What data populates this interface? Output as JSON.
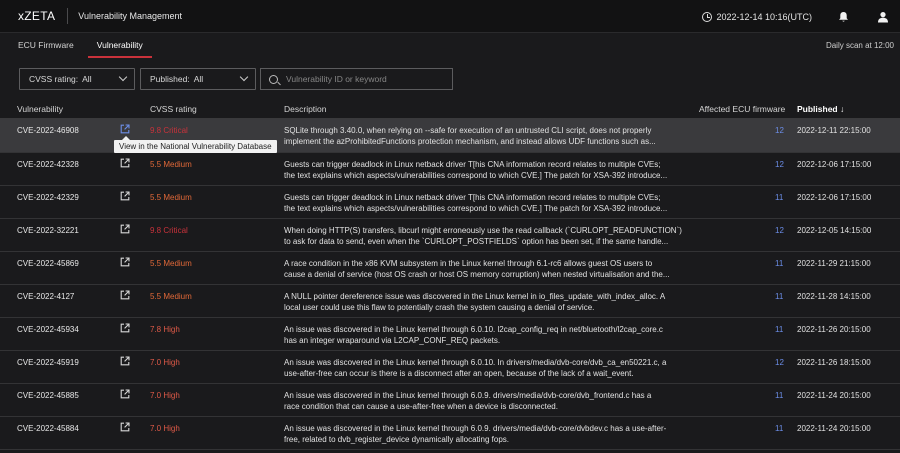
{
  "app": {
    "brand": "xZETA",
    "title": "Vulnerability Management",
    "datetime": "2022-12-14 10:16(UTC)"
  },
  "tabs": [
    {
      "label": "ECU Firmware",
      "active": false
    },
    {
      "label": "Vulnerability",
      "active": true
    }
  ],
  "scan_note": "Daily scan at 12:00",
  "filters": {
    "cvss": {
      "label": "CVSS rating:",
      "value": "All"
    },
    "published": {
      "label": "Published:",
      "value": "All"
    },
    "search": {
      "placeholder": "Vulnerability ID or keyword",
      "value": ""
    }
  },
  "table": {
    "headers": {
      "vulnerability": "Vulnerability",
      "cvss": "CVSS rating",
      "description": "Description",
      "affected": "Affected ECU firmware",
      "published": "Published ↓"
    },
    "tooltip": "View in the National Vulnerability Database",
    "rows": [
      {
        "cve": "CVE-2022-46908",
        "cvss": "9.8 Critical",
        "severity": "critical",
        "line1": "SQLite through 3.40.0, when relying on --safe for execution of an untrusted CLI script, does not properly",
        "line2": "implement the azProhibitedFunctions protection mechanism, and instead allows UDF functions such as...",
        "affected": "12",
        "published": "2022-12-11 22:15:00"
      },
      {
        "cve": "CVE-2022-42328",
        "cvss": "5.5 Medium",
        "severity": "medium",
        "line1": "Guests can trigger deadlock in Linux netback driver T[his CNA information record relates to multiple CVEs;",
        "line2": "the text explains which aspects/vulnerabilities correspond to which CVE.] The patch for XSA-392 introduce...",
        "affected": "12",
        "published": "2022-12-06 17:15:00"
      },
      {
        "cve": "CVE-2022-42329",
        "cvss": "5.5 Medium",
        "severity": "medium",
        "line1": "Guests can trigger deadlock in Linux netback driver T[his CNA information record relates to multiple CVEs;",
        "line2": "the text explains which aspects/vulnerabilities correspond to which CVE.] The patch for XSA-392 introduce...",
        "affected": "11",
        "published": "2022-12-06 17:15:00"
      },
      {
        "cve": "CVE-2022-32221",
        "cvss": "9.8 Critical",
        "severity": "critical",
        "line1": "When doing HTTP(S) transfers, libcurl might erroneously use the read callback (`CURLOPT_READFUNCTION`)",
        "line2": "to ask for data to send, even when the `CURLOPT_POSTFIELDS` option has been set, if the same handle...",
        "affected": "12",
        "published": "2022-12-05 14:15:00"
      },
      {
        "cve": "CVE-2022-45869",
        "cvss": "5.5 Medium",
        "severity": "medium",
        "line1": "A race condition in the x86 KVM subsystem in the Linux kernel through 6.1-rc6 allows guest OS users to",
        "line2": "cause a denial of service (host OS crash or host OS memory corruption) when nested virtualisation and the...",
        "affected": "11",
        "published": "2022-11-29 21:15:00"
      },
      {
        "cve": "CVE-2022-4127",
        "cvss": "5.5 Medium",
        "severity": "medium",
        "line1": "A NULL pointer dereference issue was discovered in the Linux kernel in io_files_update_with_index_alloc. A",
        "line2": "local user could use this flaw to potentially crash the system causing a denial of service.",
        "affected": "11",
        "published": "2022-11-28 14:15:00"
      },
      {
        "cve": "CVE-2022-45934",
        "cvss": "7.8 High",
        "severity": "high",
        "line1": "An issue was discovered in the Linux kernel through 6.0.10. l2cap_config_req in net/bluetooth/l2cap_core.c",
        "line2": "has an integer wraparound via L2CAP_CONF_REQ packets.",
        "affected": "11",
        "published": "2022-11-26 20:15:00"
      },
      {
        "cve": "CVE-2022-45919",
        "cvss": "7.0 High",
        "severity": "high",
        "line1": "An issue was discovered in the Linux kernel through 6.0.10. In drivers/media/dvb-core/dvb_ca_en50221.c, a",
        "line2": "use-after-free can occur is there is a disconnect after an open, because of the lack of a wait_event.",
        "affected": "12",
        "published": "2022-11-26 18:15:00"
      },
      {
        "cve": "CVE-2022-45885",
        "cvss": "7.0 High",
        "severity": "high",
        "line1": "An issue was discovered in the Linux kernel through 6.0.9. drivers/media/dvb-core/dvb_frontend.c has a",
        "line2": "race condition that can cause a use-after-free when a device is disconnected.",
        "affected": "11",
        "published": "2022-11-24 20:15:00"
      },
      {
        "cve": "CVE-2022-45884",
        "cvss": "7.0 High",
        "severity": "high",
        "line1": "An issue was discovered in the Linux kernel through 6.0.9. drivers/media/dvb-core/dvbdev.c has a use-after-",
        "line2": "free, related to dvb_register_device dynamically allocating fops.",
        "affected": "11",
        "published": "2022-11-24 20:15:00"
      }
    ]
  },
  "colors": {
    "critical": "#c9323b",
    "high": "#e05a48",
    "medium": "#e06838",
    "link": "#6c8ee8",
    "tab_accent": "#c9323b"
  },
  "icons": [
    "clock-icon",
    "bell-icon",
    "user-icon",
    "search-icon",
    "chevron-down-icon",
    "external-link-icon"
  ]
}
